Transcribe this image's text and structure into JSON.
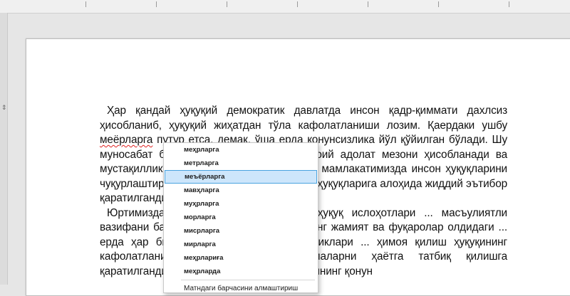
{
  "document": {
    "paragraph1_line1": "Ҳар қандай ҳуқуқий демократик давлатда инсон қадр-қиммати дахлсиз",
    "paragraph1_line2": "ҳисобланиб, ҳуқуқий жиҳатдан тўла кафолатланиши лозим. Қаердаки",
    "paragraph1_line3_a": "ушбу ",
    "paragraph1_misspelled": "меёрларга",
    "paragraph1_line3_b": " путур етса, демак, ўша ерда қонунсизлика йўл қўйилган",
    "paragraph1_line4": "бўлади. Шу муносабат билан барча қонунлар ижтимоий адолат мезони",
    "paragraph1_line5": "ҳисобланади ва мустақилликнинг дастлабки йиллариданоқ",
    "paragraph1_line6": "мамлакатимизда инсон ҳуқуқларини чуқурлаштириш мақсадида",
    "paragraph1_line7": "шахс эркиға ва ҳуқуқларига алоҳида жиддий эътибор қаратилганди.",
    "paragraph2_line1": "Юртимизда амалга оширилаётган суд-ҳуқуқ",
    "paragraph2_line2": "ислоҳотлари ... масъулиятли вазифани бажарувчи жавобгар шахсларнинг жамият ва",
    "paragraph2_line3": "фуқаролар олдидаги ... ерда ҳар бир шахс ўз ҳуқуқ ва",
    "paragraph2_line4": "эркинликлари ... ҳимоя қилиш ҳуқуқининг кафолатланиши",
    "paragraph2_line5": "тўғрисидаги ... нормаларни ҳаётга татбиқ қилишга",
    "paragraph2_line6": "қаратилганди. ... асосий мақсади эса, инсоннинг қонун"
  },
  "context_menu": {
    "suggestions": [
      "меҳрларга",
      "метрларга",
      "меъёрларга",
      "мавҳларга",
      "муҳрларга",
      "морларга",
      "мисрларга",
      "мирларга",
      "меҳрлариға",
      "меҳрларда"
    ],
    "selected_index": 2,
    "replace_all_label": "Матндаги барчасини алмаштириш"
  },
  "colors": {
    "selection_fill": "#cde6fb",
    "selection_border": "#4aa3df",
    "spell_underline": "#e02020"
  }
}
